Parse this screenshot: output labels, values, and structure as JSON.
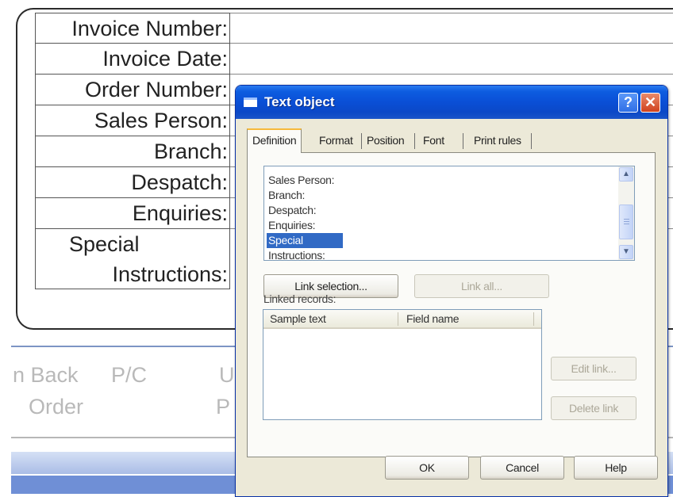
{
  "document": {
    "labels": [
      "Invoice Number:",
      "Invoice Date:",
      "Order Number:",
      "Sales Person:",
      "Branch:",
      "Despatch:",
      "Enquiries:"
    ],
    "special_line1": "Special",
    "special_line2": "Instructions:",
    "column_headings": {
      "back": "n Back",
      "order": "Order",
      "pc": "P/C",
      "u": "U",
      "p": "P"
    }
  },
  "dialog": {
    "title": "Text object",
    "help_glyph": "?",
    "close_glyph": "✕",
    "tabs": [
      "Definition",
      "Format",
      "Position",
      "Font",
      "Print rules"
    ],
    "active_tab": "Definition",
    "list_items": [
      "Sales Person:",
      "Branch:",
      "Despatch:",
      "Enquiries:",
      "Special",
      "Instructions:"
    ],
    "selected_item": "Special",
    "link_selection_label": "Link selection...",
    "link_all_label": "Link all...",
    "linked_records_label": "Linked records:",
    "columns": [
      "Sample text",
      "Field name"
    ],
    "edit_link_label": "Edit link...",
    "delete_link_label": "Delete link",
    "ok_label": "OK",
    "cancel_label": "Cancel",
    "help_label": "Help"
  },
  "colors": {
    "titlebar_blue": "#0a4fd6",
    "selection_blue": "#316ac5",
    "dialog_face": "#ece9d8",
    "active_tab_accent": "#f6b93b",
    "close_red": "#d0421e"
  }
}
